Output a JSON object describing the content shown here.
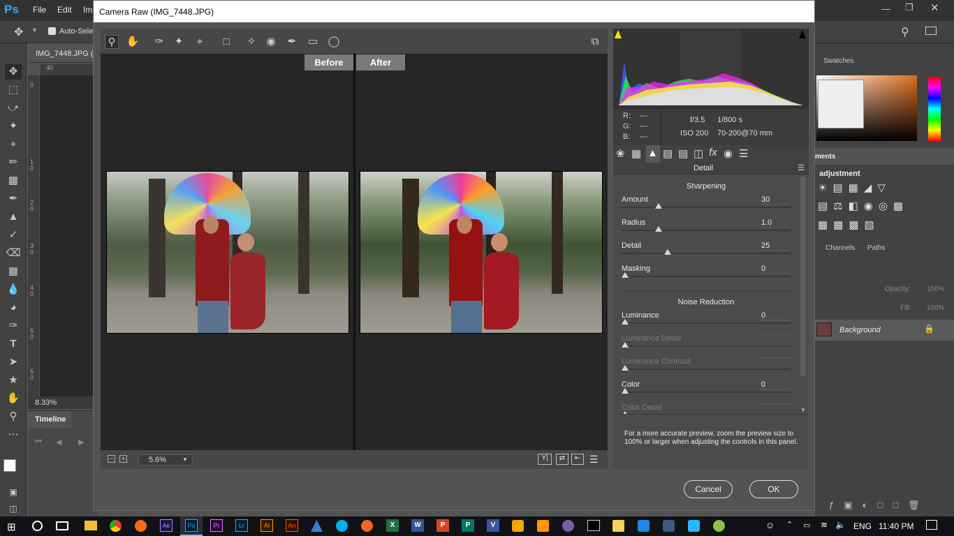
{
  "ps": {
    "logo": "Ps",
    "menu": [
      "File",
      "Edit",
      "Im"
    ],
    "options": {
      "auto_select": "Auto-Selec"
    },
    "doc_tab": "IMG_7448.JPG (",
    "ruler_top": "40",
    "ruler_left": [
      "0",
      "1\n0",
      "2\n0",
      "3\n0",
      "4\n0",
      "5\n0",
      "6\n0"
    ],
    "zoom": "8.33%",
    "timeline_title": "Timeline",
    "right": {
      "swatches_tab": "Swatches",
      "adjustments_tab": "ments",
      "add_adjustment": "adjustment",
      "channels_tab": "Channels",
      "paths_tab": "Paths",
      "opacity_label": "Opacity:",
      "opacity_value": "100%",
      "fill_label": "Fill:",
      "fill_value": "100%",
      "layer_name": "Background"
    }
  },
  "dialog": {
    "title": "Camera Raw (IMG_7448.JPG)",
    "before_label": "Before",
    "after_label": "After",
    "zoom_value": "5.6%",
    "rgb": {
      "r_label": "R:",
      "g_label": "G:",
      "b_label": "B:",
      "r": "---",
      "g": "---",
      "b": "---"
    },
    "exif": {
      "aperture": "f/3.5",
      "shutter": "1/800 s",
      "iso": "ISO 200",
      "lens": "70-200@70 mm"
    },
    "panel_title": "Detail",
    "sharpening": {
      "title": "Sharpening",
      "sliders": [
        {
          "label": "Amount",
          "value": "30",
          "fraction": 0.2
        },
        {
          "label": "Radius",
          "value": "1.0",
          "fraction": 0.2
        },
        {
          "label": "Detail",
          "value": "25",
          "fraction": 0.25
        },
        {
          "label": "Masking",
          "value": "0",
          "fraction": 0
        }
      ]
    },
    "noise": {
      "title": "Noise Reduction",
      "sliders": [
        {
          "label": "Luminance",
          "value": "0",
          "fraction": 0
        },
        {
          "label": "Luminance Detail",
          "value": "",
          "fraction": 0
        },
        {
          "label": "Luminance Contrast",
          "value": "",
          "fraction": 0
        },
        {
          "label": "Color",
          "value": "0",
          "fraction": 0
        },
        {
          "label": "Color Detail",
          "value": "",
          "fraction": 0
        }
      ]
    },
    "note": "For a more accurate preview, zoom the preview size to 100% or larger when adjusting the controls in this panel.",
    "cancel_label": "Cancel",
    "ok_label": "OK"
  },
  "taskbar": {
    "lang": "ENG",
    "time": "11:40 PM",
    "apps": [
      "Ae",
      "Ps",
      "Pr",
      "Lr",
      "Ai",
      "An",
      "X",
      "W",
      "P",
      "P",
      "V"
    ]
  },
  "colors": {
    "ps_blue": "#31a8ff",
    "ae": "#9999ff",
    "pr": "#e77bff",
    "lr": "#31a8ff",
    "ai": "#ff9a00",
    "an": "#ff5a00"
  }
}
